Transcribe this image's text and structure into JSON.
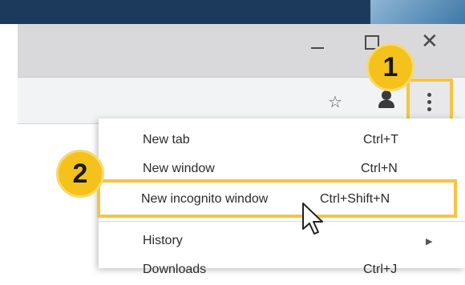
{
  "menu": {
    "items": [
      {
        "label": "New tab",
        "shortcut": "Ctrl+T"
      },
      {
        "label": "New window",
        "shortcut": "Ctrl+N"
      },
      {
        "label": "New incognito window",
        "shortcut": "Ctrl+Shift+N"
      },
      {
        "label": "History",
        "shortcut": ""
      },
      {
        "label": "Downloads",
        "shortcut": "Ctrl+J"
      }
    ]
  },
  "badges": {
    "step1": "1",
    "step2": "2"
  },
  "window_controls": {
    "minimize": "—",
    "maximize": "",
    "close": "✕"
  },
  "icons": {
    "star": "☆",
    "submenu_arrow": "▶"
  },
  "colors": {
    "highlight": "#f4c542",
    "badge": "#f4c21b",
    "desktop": "#1b3a5c"
  }
}
